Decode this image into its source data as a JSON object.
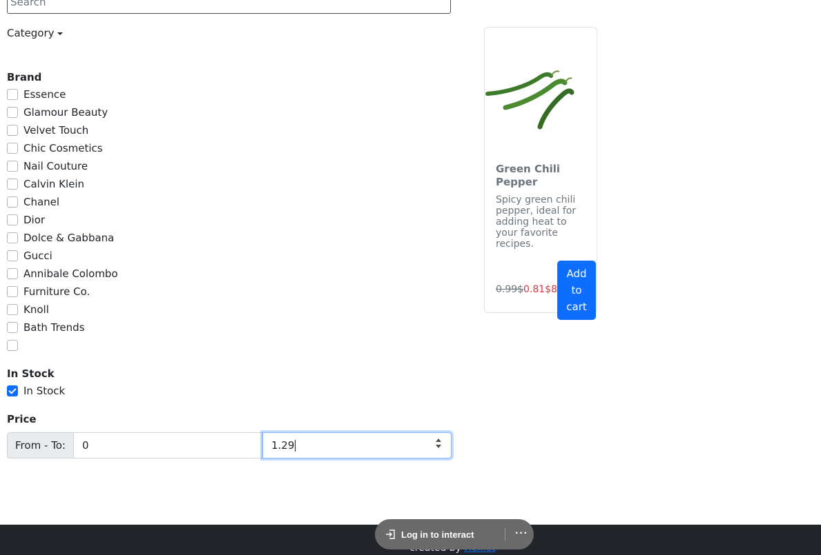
{
  "search": {
    "placeholder": "Search"
  },
  "category": {
    "label": "Category"
  },
  "brand": {
    "heading": "Brand",
    "items": [
      "Essence",
      "Glamour Beauty",
      "Velvet Touch",
      "Chic Cosmetics",
      "Nail Couture",
      "Calvin Klein",
      "Chanel",
      "Dior",
      "Dolce & Gabbana",
      "Gucci",
      "Annibale Colombo",
      "Furniture Co.",
      "Knoll",
      "Bath Trends",
      ""
    ]
  },
  "stock": {
    "heading": "In Stock",
    "label": "In Stock",
    "checked": true
  },
  "price": {
    "heading": "Price",
    "prefix": "From - To:",
    "from": "0",
    "to": "1.29"
  },
  "product": {
    "title": "Green Chili Pepper",
    "description": "Spicy green chili pepper, ideal for adding heat to your favorite recipes.",
    "old_price": "0.99$",
    "new_price": "0.81$8",
    "button": "Add to cart",
    "image_icon": "green-chili-pepper"
  },
  "footer": {
    "text": "created by ",
    "link": "Hexlet"
  },
  "overlay": {
    "login_label": "Log in to interact",
    "more_icon": "ellipsis-icon"
  },
  "colors": {
    "primary": "#0d6efd",
    "danger": "#dc3545",
    "footer_bg": "#212529"
  }
}
